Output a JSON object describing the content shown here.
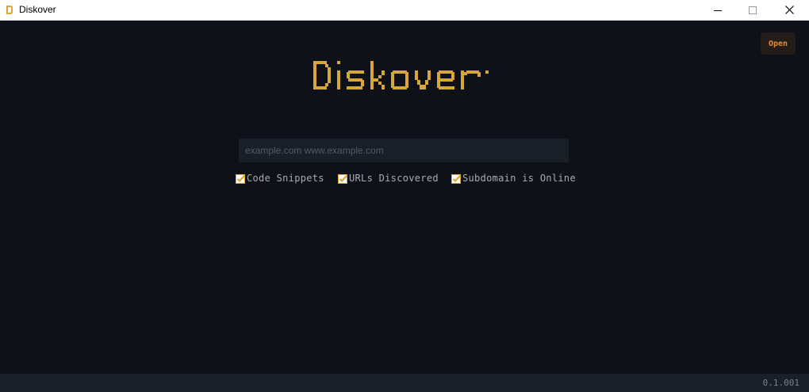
{
  "window": {
    "title": "Diskover",
    "icon": "diskover-app-icon",
    "controls": [
      "minimize-icon",
      "maximize-icon",
      "close-icon"
    ]
  },
  "header": {
    "open_label": "Open"
  },
  "logo": {
    "text": "Diskover"
  },
  "search": {
    "placeholder": "example.com www.example.com",
    "value": ""
  },
  "options": [
    {
      "label": "Code Snippets",
      "checked": true
    },
    {
      "label": "URLs Discovered",
      "checked": true
    },
    {
      "label": "Subdomain is Online",
      "checked": true
    }
  ],
  "footer": {
    "version": "0.1.001"
  },
  "colors": {
    "background": "#0e1118",
    "accent": "#d9a63b",
    "open_button_text": "#e48b38",
    "footer": "#1b1f27"
  }
}
